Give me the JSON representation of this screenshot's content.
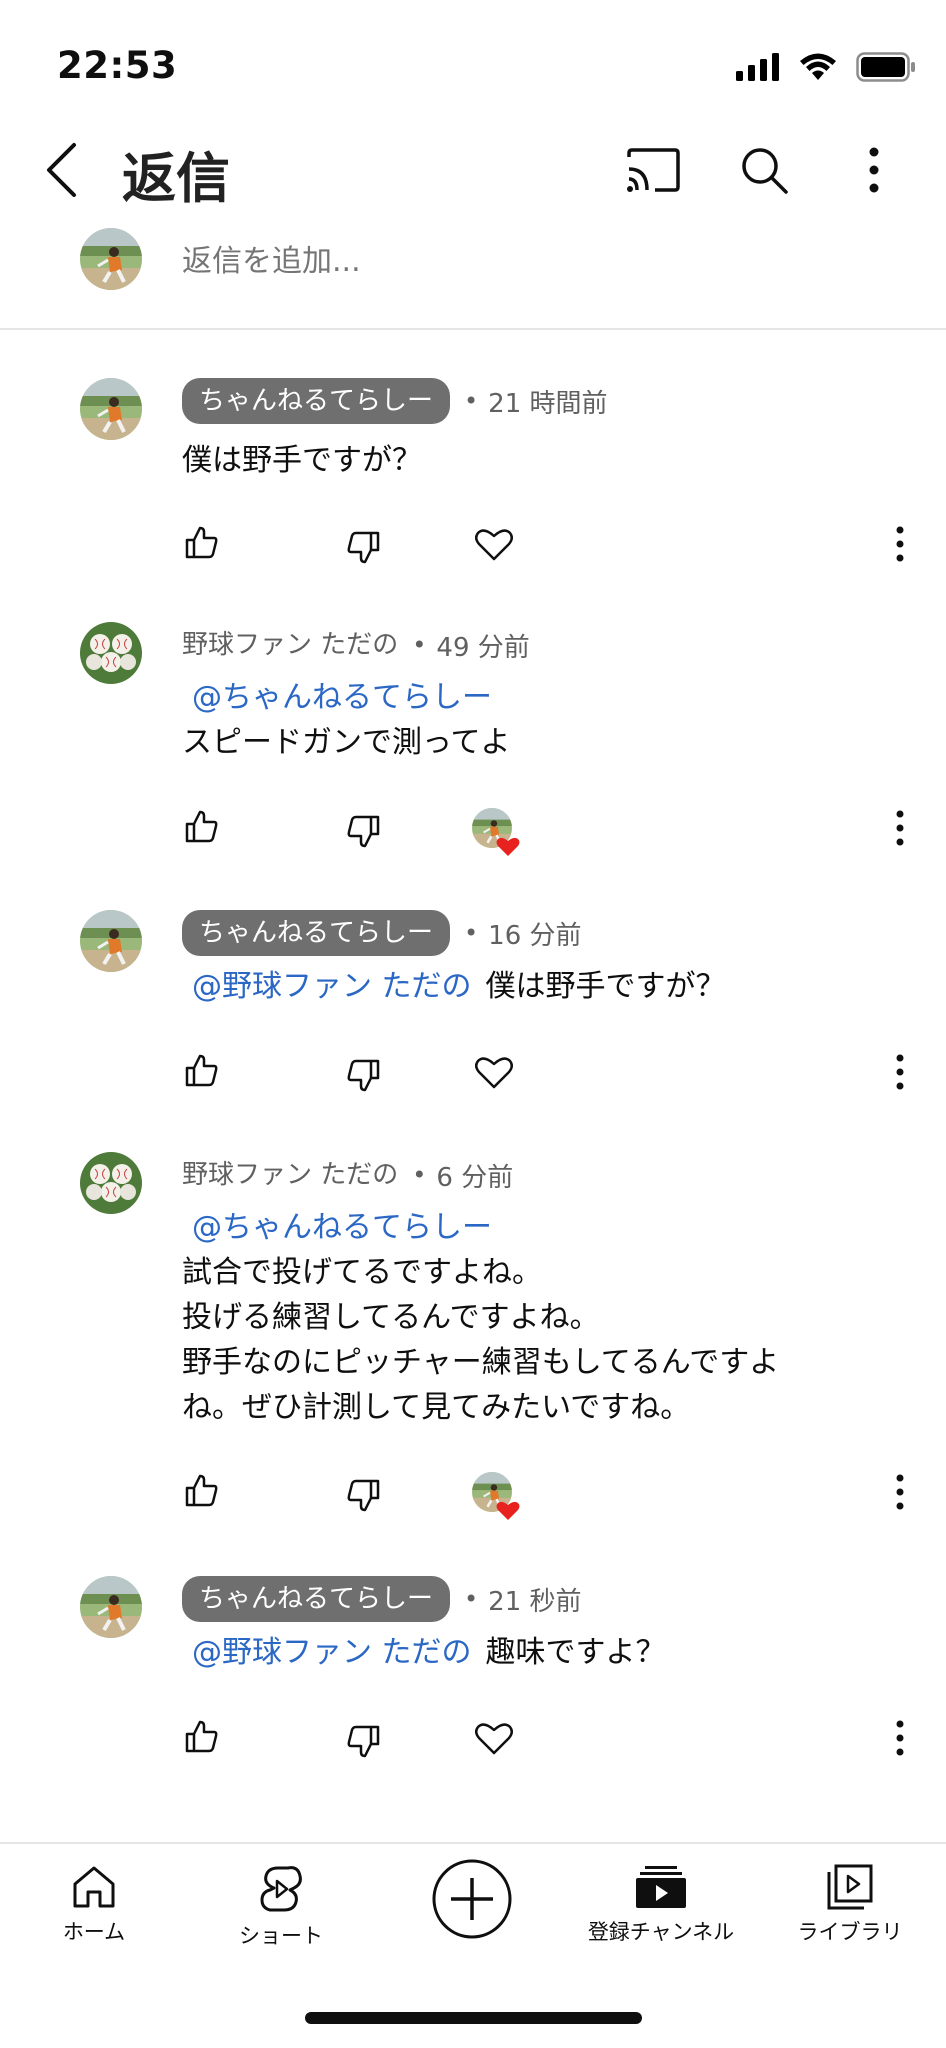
{
  "status": {
    "time": "22:53"
  },
  "header": {
    "title": "返信"
  },
  "add_reply": {
    "placeholder": "返信を追加..."
  },
  "comments": [
    {
      "author": "ちゃんねるてらしー",
      "author_is_creator": true,
      "time": "21 時間前",
      "mention": "",
      "lines": [
        "僕は野手ですが？"
      ]
    },
    {
      "author": "野球ファン ただの",
      "author_is_creator": false,
      "time": "49 分前",
      "mention": "@ちゃんねるてらしー",
      "lines": [
        "スピードガンで測ってよ"
      ],
      "creator_hearted": true
    },
    {
      "author": "ちゃんねるてらしー",
      "author_is_creator": true,
      "time": "16 分前",
      "mention": "@野球ファン ただの",
      "lines": [
        "僕は野手ですが？"
      ]
    },
    {
      "author": "野球ファン ただの",
      "author_is_creator": false,
      "time": "6 分前",
      "mention": "@ちゃんねるてらしー",
      "lines": [
        "試合で投げてるですよね。",
        "投げる練習してるんですよね。",
        "野手なのにピッチャー練習もしてるんですよ",
        "ね。ぜひ計測して見てみたいですね。"
      ],
      "creator_hearted": true
    },
    {
      "author": "ちゃんねるてらしー",
      "author_is_creator": true,
      "time": "21 秒前",
      "mention": "@野球ファン ただの",
      "lines": [
        "趣味ですよ？"
      ]
    }
  ],
  "bottom_nav": {
    "home": "ホーム",
    "shorts": "ショート",
    "subscriptions": "登録チャンネル",
    "library": "ライブラリ"
  },
  "colors": {
    "mention": "#2b67c4",
    "creator_pill": "#6f6f6f",
    "heart": "#e8221f"
  }
}
